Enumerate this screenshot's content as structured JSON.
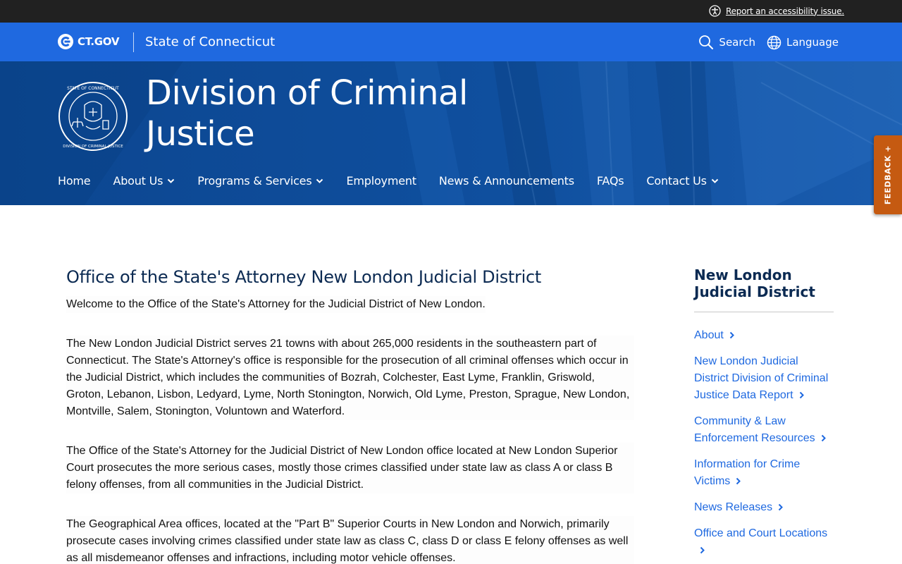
{
  "utility": {
    "accessibility_link": "Report an accessibility issue."
  },
  "ctgov": {
    "logo_text": "CT.GOV",
    "state_name": "State of Connecticut",
    "search_label": "Search",
    "language_label": "Language"
  },
  "agency": {
    "title_line1": "Division of Criminal",
    "title_line2": "Justice",
    "seal_text_top": "STATE OF CONNECTICUT",
    "seal_text_bottom": "DIVISION OF CRIMINAL JUSTICE"
  },
  "nav": {
    "items": [
      {
        "label": "Home",
        "has_dropdown": false
      },
      {
        "label": "About Us",
        "has_dropdown": true
      },
      {
        "label": "Programs & Services",
        "has_dropdown": true
      },
      {
        "label": "Employment",
        "has_dropdown": false
      },
      {
        "label": "News & Announcements",
        "has_dropdown": false
      },
      {
        "label": "FAQs",
        "has_dropdown": false
      },
      {
        "label": "Contact Us",
        "has_dropdown": true
      }
    ]
  },
  "feedback": {
    "label": "FEEDBACK +"
  },
  "main": {
    "title": "Office of the State's Attorney New London Judicial District",
    "paragraphs": [
      "Welcome to the Office of the State's Attorney for the Judicial District of New London.",
      "The New London Judicial District serves 21 towns with about 265,000 residents in the southeastern part of Connecticut. The State's Attorney's office is responsible for the prosecution of all criminal offenses which occur in the Judicial District, which includes the communities of Bozrah, Colchester, East Lyme, Franklin, Griswold, Groton, Lebanon, Lisbon, Ledyard, Lyme, North Stonington, Norwich, Old Lyme, Preston, Sprague, New London, Montville, Salem, Stonington, Voluntown and Waterford.",
      "The Office of the State's Attorney for the Judicial District of New London office located at New London Superior Court prosecutes the more serious cases, mostly those crimes classified under state law as class A or class B felony offenses, from all communities in the Judicial District.",
      "The Geographical Area offices, located at the \"Part B\" Superior Courts in New London and Norwich, primarily prosecute cases involving crimes classified under state law as class C, class D or class E felony offenses as well as all misdemeanor offenses and infractions, including motor vehicle offenses."
    ]
  },
  "sidebar": {
    "title": "New London Judicial District",
    "links": [
      "About",
      "New London Judicial District Division of Criminal Justice Data Report",
      "Community & Law Enforcement Resources",
      "Information for Crime Victims",
      "News Releases",
      "Office and Court Locations"
    ]
  },
  "colors": {
    "utility_bar": "#212121",
    "ctgov_blue": "#1f69e0",
    "hero_blue": "#0d4a96",
    "heading_navy": "#0b2a52",
    "link_blue": "#1f69e0",
    "feedback_orange": "#c55a11"
  },
  "icons": {
    "accessibility": "accessibility-icon",
    "search": "search-icon",
    "language": "globe-icon",
    "dropdown": "chevron-down-icon",
    "sidebar_arrow": "chevron-right-icon"
  }
}
